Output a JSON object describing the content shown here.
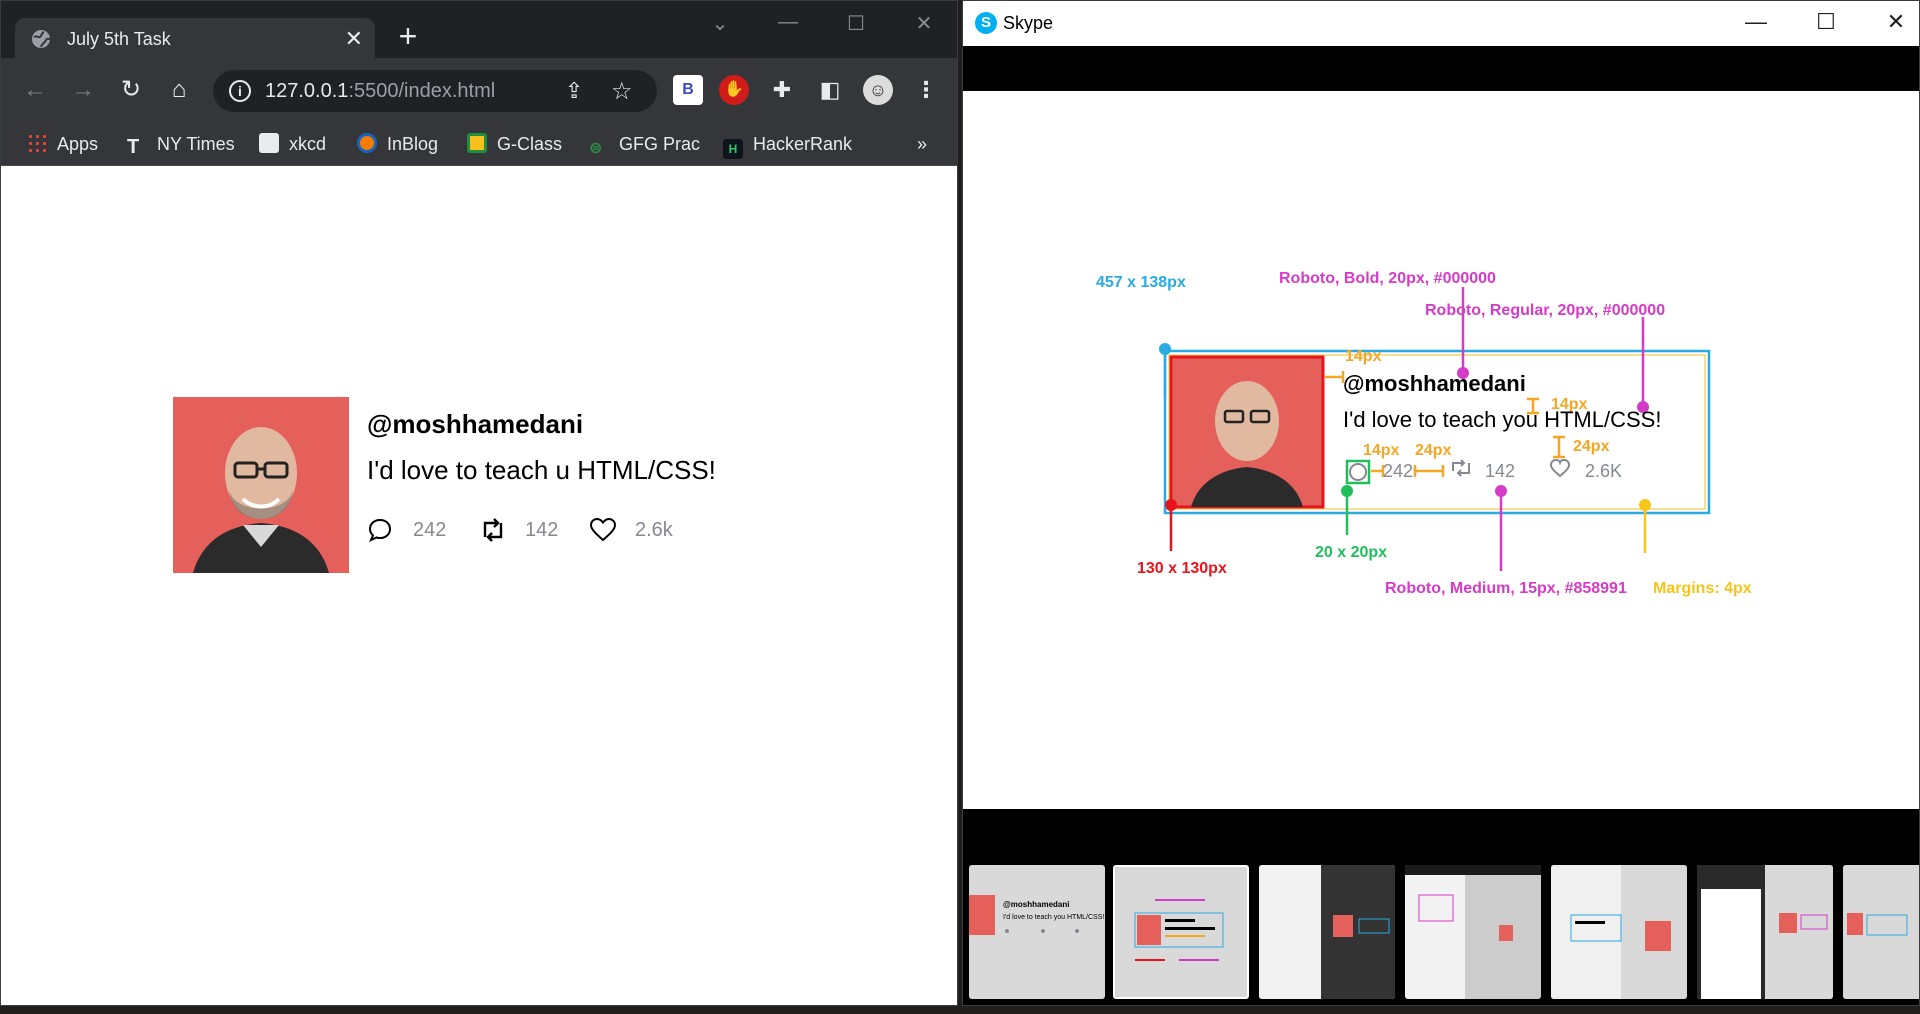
{
  "browser": {
    "tab_title": "July 5th Task",
    "url_host": "127.0.0.1",
    "url_path": ":5500/index.html",
    "bookmarks": [
      "Apps",
      "NY Times",
      "xkcd",
      "InBlog",
      "G-Class",
      "GFG Prac",
      "HackerRank"
    ],
    "more_bookmarks": "»",
    "extension_b": "B"
  },
  "tweet": {
    "handle": "@moshhamedani",
    "text": "I'd love to teach u HTML/CSS!",
    "comments": "242",
    "retweets": "142",
    "likes": "2.6k"
  },
  "skype": {
    "title": "Skype",
    "annotation": {
      "card_size": "457 x 138px",
      "bold_font": "Roboto, Bold, 20px, #000000",
      "regular_font": "Roboto, Regular, 20px, #000000",
      "medium_font": "Roboto, Medium, 15px, #858991",
      "gap_14a": "14px",
      "gap_14b": "14px",
      "gap_14c": "14px",
      "gap_24a": "24px",
      "gap_24b": "24px",
      "image_size": "130 x 130px",
      "icon_size": "20 x 20px",
      "margins": "Margins: 4px",
      "handle": "@moshhamedani",
      "text": "I'd love to teach you HTML/CSS!",
      "comments": "242",
      "retweets": "142",
      "likes": "2.6K"
    },
    "thumb1": {
      "handle": "@moshhamedani",
      "text": "I'd love to teach you HTML/CSS!"
    }
  },
  "colors": {
    "cyan": "#29abe2",
    "magenta": "#d63bc7",
    "orange": "#f5a623",
    "green": "#1fbf5b",
    "red": "#e8141c",
    "yellow": "#f5c518",
    "avatar_bg": "#e5605a"
  }
}
